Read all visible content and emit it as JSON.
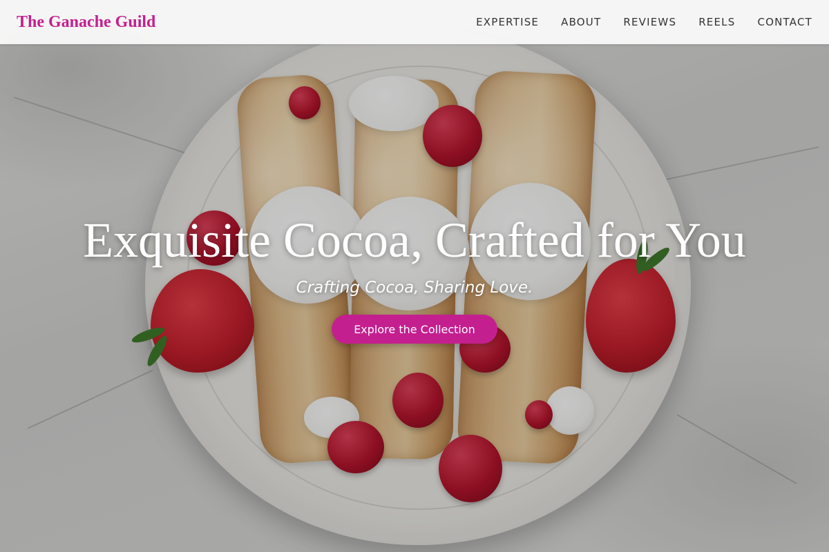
{
  "nav": {
    "brand": "The Ganache Guild",
    "links": [
      {
        "label": "EXPERTISE"
      },
      {
        "label": "ABOUT"
      },
      {
        "label": "REVIEWS"
      },
      {
        "label": "REELS"
      },
      {
        "label": "CONTACT"
      }
    ]
  },
  "hero": {
    "title": "Exquisite Cocoa, Crafted for You",
    "subtitle": "Crafting Cocoa, Sharing Love.",
    "cta_label": "Explore the Collection",
    "image_subject": "crepes-with-cream-and-berries"
  },
  "colors": {
    "brand_accent": "#c41f8f",
    "nav_background": "#f8f8f8",
    "nav_text": "#333333",
    "hero_text": "#ffffff"
  }
}
